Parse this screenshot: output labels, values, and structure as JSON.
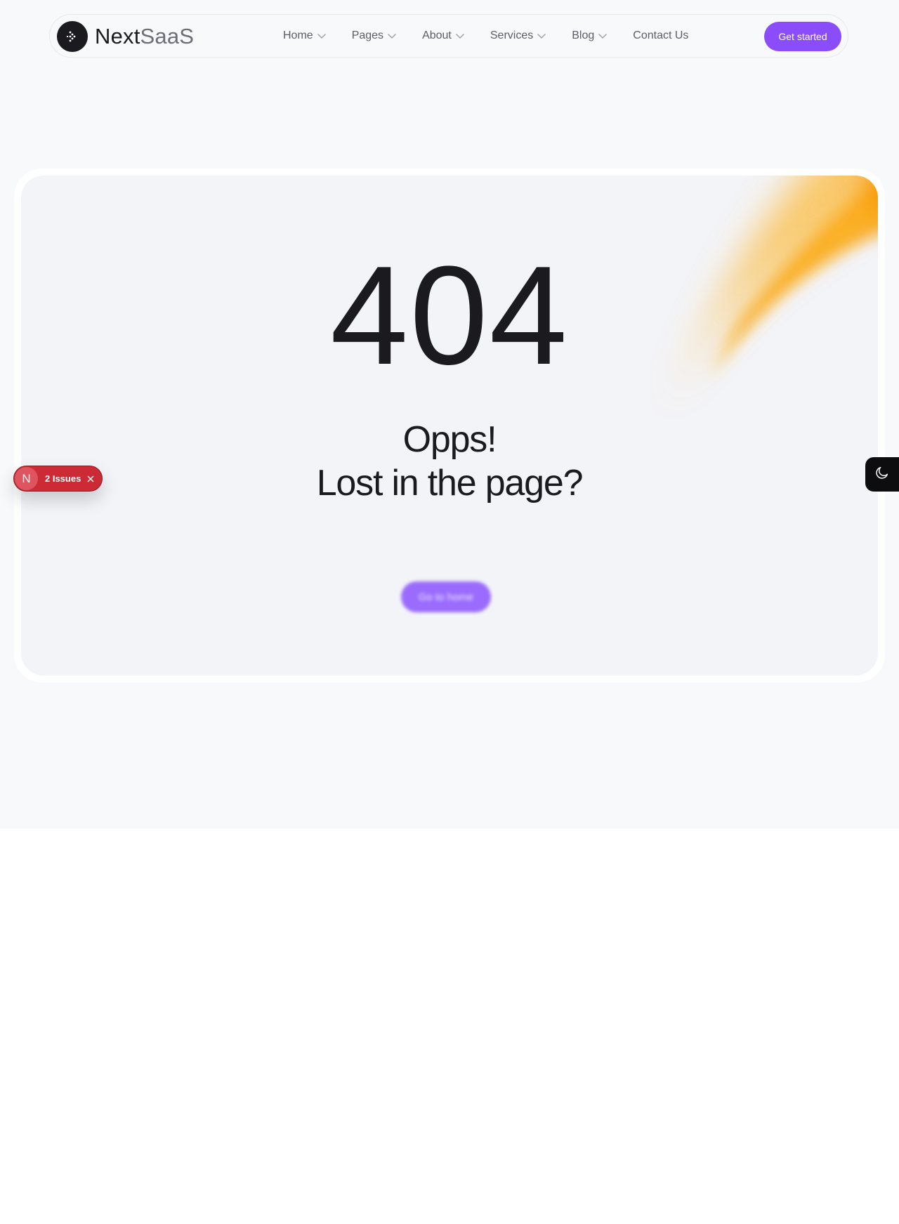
{
  "brand": {
    "name_part1": "Next",
    "name_part2": "SaaS",
    "logo_icon": "arrow-dots-icon"
  },
  "nav": {
    "items": [
      {
        "label": "Home",
        "has_dropdown": true
      },
      {
        "label": "Pages",
        "has_dropdown": true
      },
      {
        "label": "About",
        "has_dropdown": true
      },
      {
        "label": "Services",
        "has_dropdown": true
      },
      {
        "label": "Blog",
        "has_dropdown": true
      },
      {
        "label": "Contact Us",
        "has_dropdown": false
      }
    ],
    "cta_label": "Get started"
  },
  "error": {
    "code": "404",
    "title": "Opps!",
    "subtitle": "Lost in the page?",
    "button_label": "Go to home"
  },
  "issues_badge": {
    "initial": "N",
    "text": "2 Issues",
    "close_icon": "close-icon"
  },
  "theme_toggle": {
    "icon": "moon-icon"
  },
  "colors": {
    "accent": "#8b4dfa",
    "page_bg": "#f8f9fb",
    "card_bg": "#f3f4f8",
    "text_dark": "#1b1b1f",
    "nav_text": "#5a5d66",
    "issues_red": "#cc2a35",
    "flare_orange": "#f99a08"
  }
}
